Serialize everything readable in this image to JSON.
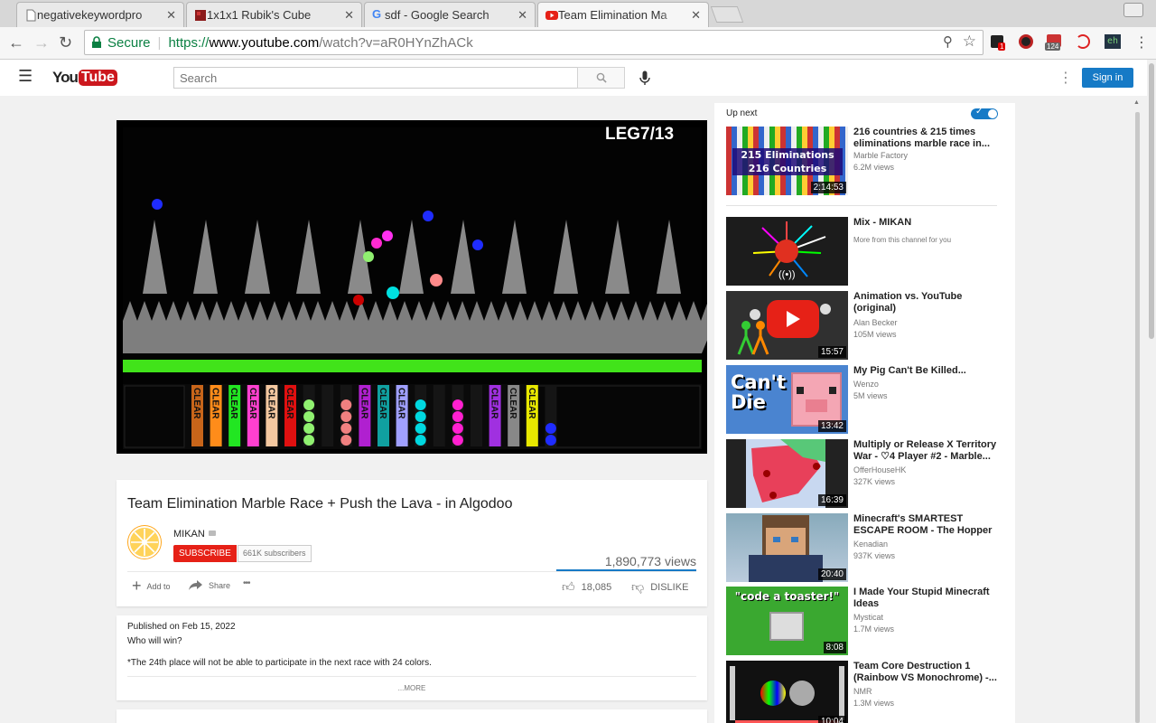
{
  "browser": {
    "tabs": [
      {
        "title": "negativekeywordpro"
      },
      {
        "title": "1x1x1 Rubik's Cube"
      },
      {
        "title": "sdf - Google Search"
      },
      {
        "title": "Team Elimination Ma"
      }
    ],
    "secure_label": "Secure",
    "url_scheme": "https://",
    "url_host": "www.youtube.com",
    "url_path": "/watch?v=aR0HYnZhACk",
    "ext_badges": {
      "notifications": "1",
      "count": "124",
      "eh": "eh"
    }
  },
  "header": {
    "logo_text": "YouTube",
    "search_placeholder": "Search",
    "sign_in": "Sign in"
  },
  "player": {
    "overlay": "LEG7/13",
    "clear_label": "CLEAR"
  },
  "video": {
    "title": "Team Elimination Marble Race + Push the Lava - in Algodoo",
    "channel": "MIKAN",
    "subscribe": "SUBSCRIBE",
    "subscribers": "661K subscribers",
    "views": "1,890,773 views",
    "add_to": "Add to",
    "share": "Share",
    "more": "•••",
    "likes": "18,085",
    "dislike": "DISLIKE"
  },
  "description": {
    "published": "Published on Feb 15, 2022",
    "line1": "Who will win?",
    "line2": "*The 24th place will not be able to participate in the next race with 24 colors.",
    "more": "...MORE"
  },
  "sidebar": {
    "up_next": "Up next",
    "recommendations": [
      {
        "title": "216 countries & 215 times eliminations marble race in...",
        "channel": "Marble Factory",
        "views": "6.2M views",
        "duration": "2:14:53",
        "thumb_text": "215 Eliminations 216 Countries"
      },
      {
        "title": "Mix - MIKAN",
        "channel": "More from this channel for you",
        "views": "",
        "duration": ""
      },
      {
        "title": "Animation vs. YouTube (original)",
        "channel": "Alan Becker",
        "views": "105M views",
        "duration": "15:57"
      },
      {
        "title": "My Pig Can't Be Killed...",
        "channel": "Wenzo",
        "views": "5M views",
        "duration": "13:42",
        "thumb_text": "Can't Die"
      },
      {
        "title": "Multiply or Release X Territory War - ♡4 Player #2 - Marble...",
        "channel": "OfferHouseHK",
        "views": "327K views",
        "duration": "16:39"
      },
      {
        "title": "Minecraft's SMARTEST ESCAPE ROOM - The Hopper",
        "channel": "Kenadian",
        "views": "937K views",
        "duration": "20:40"
      },
      {
        "title": "I Made Your Stupid Minecraft Ideas",
        "channel": "Mysticat",
        "views": "1.7M views",
        "duration": "8:08",
        "thumb_text": "\"code a toaster!\""
      },
      {
        "title": "Team Core Destruction 1 (Rainbow VS Monochrome) -...",
        "channel": "NMR",
        "views": "1.3M views",
        "duration": "10:04"
      }
    ]
  },
  "colors": {
    "yt_red": "#cc181e",
    "link_blue": "#167ac6",
    "secure_green": "#0b8043"
  }
}
